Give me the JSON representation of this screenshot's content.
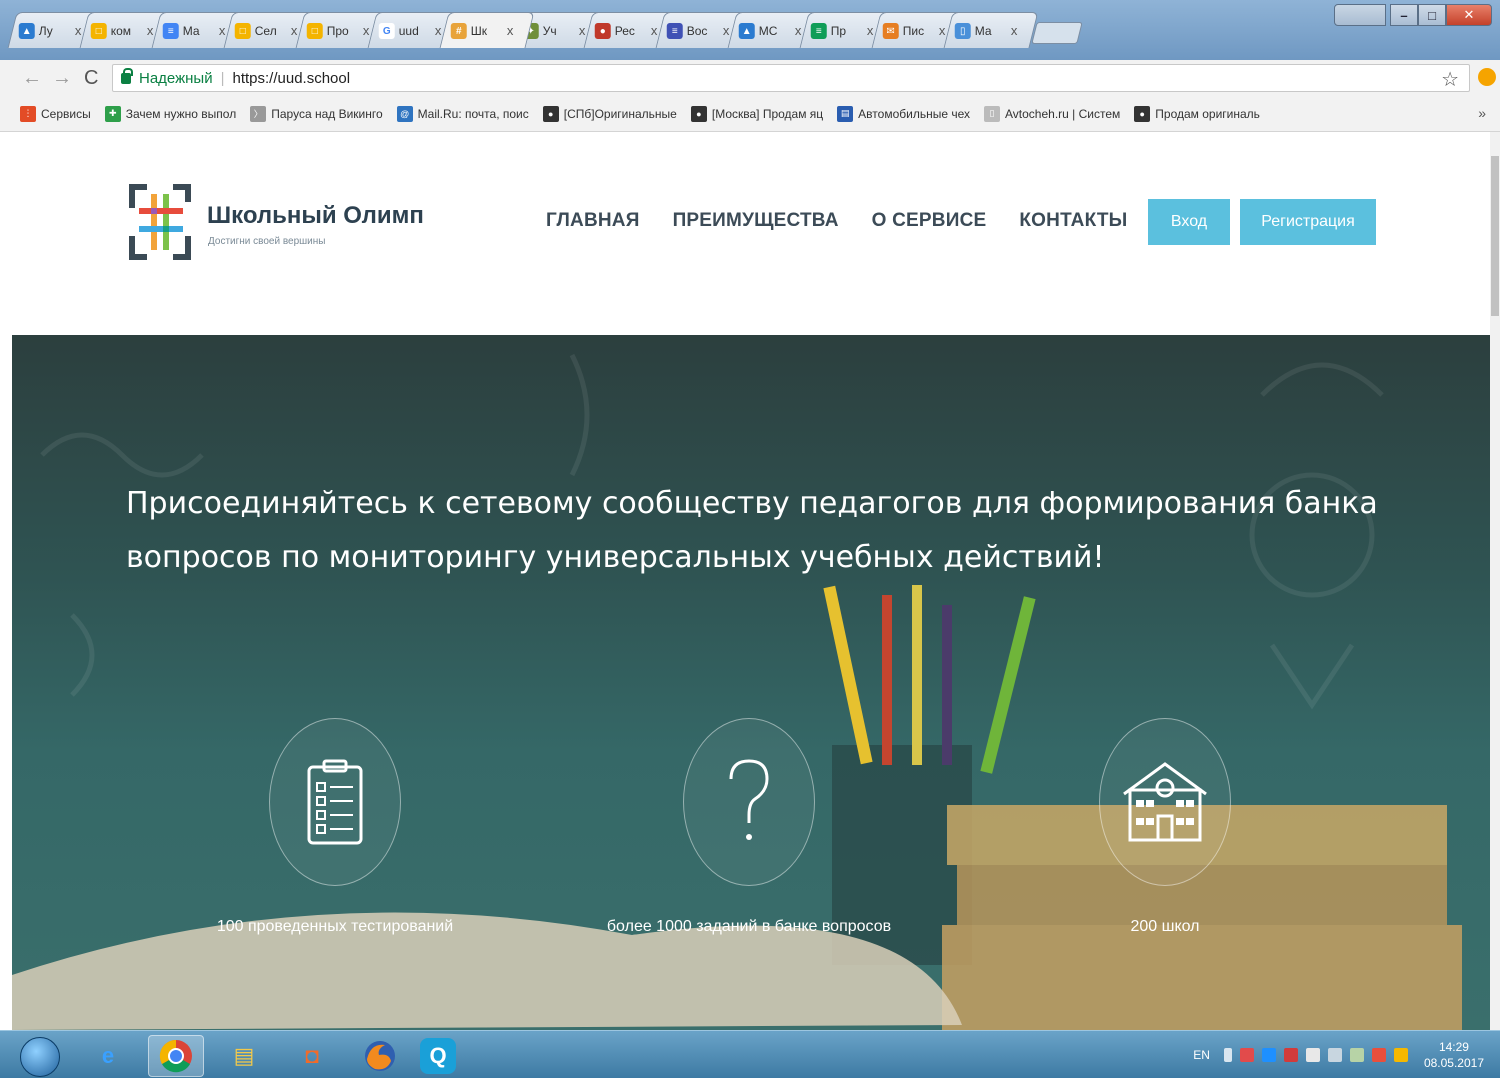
{
  "browser": {
    "tabs": [
      {
        "title": "Лу",
        "color": "#2b7bd0",
        "glyph": "▲"
      },
      {
        "title": "ком",
        "color": "#f4b400",
        "glyph": "□"
      },
      {
        "title": "Ма",
        "color": "#4285f4",
        "glyph": "≡"
      },
      {
        "title": "Сел",
        "color": "#f4b400",
        "glyph": "□"
      },
      {
        "title": "Про",
        "color": "#f4b400",
        "glyph": "□"
      },
      {
        "title": "uud",
        "color": "#ffffff",
        "glyph": "G"
      },
      {
        "title": "Шк",
        "color": "#e8a33a",
        "glyph": "#",
        "active": true
      },
      {
        "title": "Уч",
        "color": "#6f8f3a",
        "glyph": "✦"
      },
      {
        "title": "Рес",
        "color": "#c0392b",
        "glyph": "●"
      },
      {
        "title": "Вос",
        "color": "#3f51b5",
        "glyph": "≡"
      },
      {
        "title": "МС",
        "color": "#2b7bd0",
        "glyph": "▲"
      },
      {
        "title": "Пр",
        "color": "#0f9d58",
        "glyph": "≡"
      },
      {
        "title": "Пис",
        "color": "#e67e22",
        "glyph": "✉"
      },
      {
        "title": "Ма",
        "color": "#4a90d9",
        "glyph": "▯"
      }
    ],
    "tab_close": "x",
    "window_user": "",
    "address": {
      "secure_label": "Надежный",
      "separator": "|",
      "url": "https://uud.school"
    },
    "bookmarks": [
      {
        "label": "Сервисы",
        "color": "#e34c26",
        "glyph": "⋮"
      },
      {
        "label": "Зачем нужно выпол",
        "color": "#2e9f4a",
        "glyph": "✚"
      },
      {
        "label": "Паруса над Викинго",
        "color": "#999999",
        "glyph": "〉"
      },
      {
        "label": "Mail.Ru: почта, поис",
        "color": "#2f74c0",
        "glyph": "@"
      },
      {
        "label": "[СПб]Оригинальные",
        "color": "#333333",
        "glyph": "●"
      },
      {
        "label": "[Москва] Продам яц",
        "color": "#333333",
        "glyph": "●"
      },
      {
        "label": "Автомобильные чех",
        "color": "#2a5db0",
        "glyph": "▤"
      },
      {
        "label": "Avtocheh.ru | Систем",
        "color": "#bbbbbb",
        "glyph": "▯"
      },
      {
        "label": "Продам оригиналь",
        "color": "#333333",
        "glyph": "●"
      }
    ],
    "bookmarks_more": "»"
  },
  "site": {
    "brand": {
      "name": "Школьный Олимп",
      "tagline": "Достигни своей вершины"
    },
    "nav": [
      "ГЛАВНАЯ",
      "ПРЕИМУЩЕСТВА",
      "О СЕРВИСЕ",
      "КОНТАКТЫ"
    ],
    "login_label": "Вход",
    "register_label": "Регистрация",
    "accent_color": "#5bc0de",
    "hero": {
      "title": "Присоединяйтесь к сетевому сообществу педагогов для формирования банка вопросов по мониторингу универсальных учебных действий!",
      "stats": [
        {
          "icon": "clipboard-icon",
          "caption": "100 проведенных тестирований"
        },
        {
          "icon": "question-icon",
          "caption": "более 1000 заданий в банке вопросов"
        },
        {
          "icon": "school-building-icon",
          "caption": "200 школ"
        }
      ]
    }
  },
  "taskbar": {
    "apps": [
      "ie-icon",
      "chrome-icon",
      "explorer-icon",
      "media-player-icon",
      "firefox-icon",
      "qip-icon"
    ],
    "language": "EN",
    "time": "14:29",
    "date": "08.05.2017"
  }
}
